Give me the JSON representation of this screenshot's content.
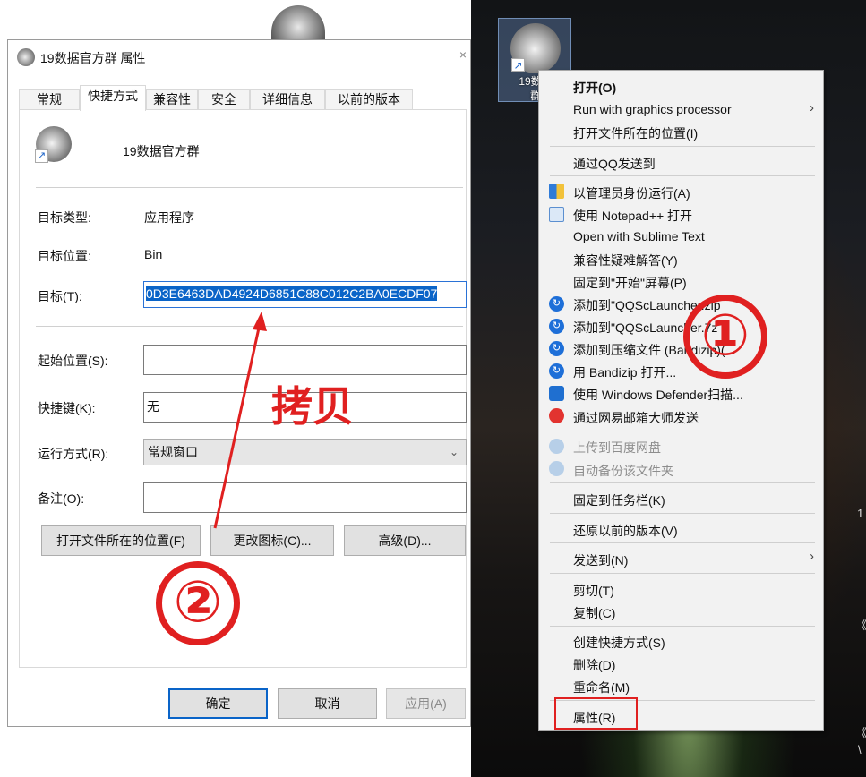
{
  "desktop": {
    "icon_label_line1": "19数据",
    "icon_label_line2": "群",
    "edge_glyphs": [
      "1",
      "《",
      "《",
      "\\"
    ]
  },
  "dialog": {
    "title": "19数据官方群 属性",
    "close_glyph": "×",
    "tabs": [
      "常规",
      "快捷方式",
      "兼容性",
      "安全",
      "详细信息",
      "以前的版本"
    ],
    "active_tab": "快捷方式",
    "shortcut_name": "19数据官方群",
    "target_type_label": "目标类型:",
    "target_type_value": "应用程序",
    "target_location_label": "目标位置:",
    "target_location_value": "Bin",
    "target_label": "目标(T):",
    "target_value": "0D3E6463DAD4924D6851C88C012C2BA0ECDF07",
    "start_in_label": "起始位置(S):",
    "start_in_value": "",
    "hotkey_label": "快捷键(K):",
    "hotkey_value": "无",
    "run_label": "运行方式(R):",
    "run_value": "常规窗口",
    "comment_label": "备注(O):",
    "comment_value": "",
    "btn_open_location": "打开文件所在的位置(F)",
    "btn_change_icon": "更改图标(C)...",
    "btn_advanced": "高级(D)...",
    "btn_ok": "确定",
    "btn_cancel": "取消",
    "btn_apply": "应用(A)"
  },
  "context_menu": {
    "items": [
      {
        "label": "打开(O)",
        "bold": true
      },
      {
        "label": "Run with graphics processor",
        "submenu": true
      },
      {
        "label": "打开文件所在的位置(I)"
      },
      {
        "label": "通过QQ发送到"
      },
      {
        "label": "以管理员身份运行(A)",
        "icon": "uac-shield-icon"
      },
      {
        "label": "使用 Notepad++ 打开",
        "icon": "notepad-plus-plus-icon"
      },
      {
        "label": "Open with Sublime Text"
      },
      {
        "label": "兼容性疑难解答(Y)"
      },
      {
        "label": "固定到\"开始\"屏幕(P)"
      },
      {
        "label": "添加到\"QQScLauncher.zip",
        "icon": "bandizip-icon"
      },
      {
        "label": "添加到\"QQScLauncher.7z",
        "icon": "bandizip-icon"
      },
      {
        "label": "添加到压缩文件 (Bandizip)(...",
        "icon": "bandizip-icon"
      },
      {
        "label": "用 Bandizip 打开...",
        "icon": "bandizip-icon"
      },
      {
        "label": "使用 Windows Defender扫描...",
        "icon": "windows-defender-icon"
      },
      {
        "label": "通过网易邮箱大师发送",
        "icon": "netease-mail-icon"
      },
      {
        "label": "上传到百度网盘",
        "icon": "baidu-netdisk-icon",
        "disabled": true
      },
      {
        "label": "自动备份该文件夹",
        "icon": "baidu-netdisk-icon",
        "disabled": true
      },
      {
        "label": "固定到任务栏(K)"
      },
      {
        "label": "还原以前的版本(V)"
      },
      {
        "label": "发送到(N)",
        "submenu": true
      },
      {
        "label": "剪切(T)"
      },
      {
        "label": "复制(C)"
      },
      {
        "label": "创建快捷方式(S)"
      },
      {
        "label": "删除(D)"
      },
      {
        "label": "重命名(M)"
      },
      {
        "label": "属性(R)"
      }
    ]
  },
  "annotations": {
    "step1": "①",
    "step2": "②",
    "copy_label": "拷贝",
    "accent_color": "#e02020"
  }
}
